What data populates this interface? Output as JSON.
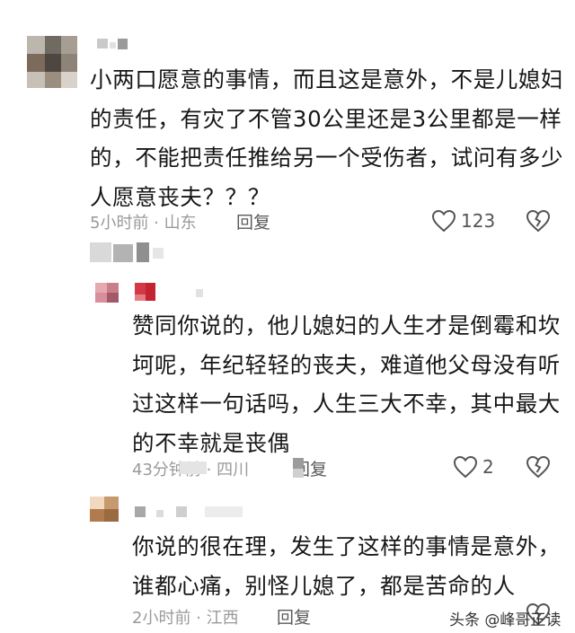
{
  "comments": [
    {
      "text_lines": [
        "小两口愿意的事情，而且这是意外，不是儿媳妇",
        "的责任，有灾了不管30公里还是3公里都是一样",
        "的，不能把责任推给另一个受伤者，试问有多少",
        "人愿意丧夫？？？"
      ],
      "time": "5小时前 · 山东",
      "reply_label": "回复",
      "likes": "123"
    },
    {
      "text_lines": [
        "赞同你说的，他儿媳妇的人生才是倒霉和坎",
        "坷呢，年纪轻轻的丧夫，难道他父母没有听",
        "过这样一句话吗，人生三大不幸，其中最大",
        "的不幸就是丧偶"
      ],
      "time": "43分钟前 · 四川",
      "reply_label": "回复",
      "likes": "2"
    },
    {
      "text_lines": [
        "你说的很在理，发生了这样的事情是意外，",
        "谁都心痛，别怪儿媳了，都是苦命的人"
      ],
      "time": "2小时前 · 江西",
      "reply_label": "回复"
    }
  ],
  "watermark": "头条 @峰哥正读",
  "icons": {
    "like": "heart-outline-icon",
    "dislike": "broken-heart-icon"
  },
  "colors": {
    "text": "#161616",
    "meta": "#9a9a9a",
    "icon": "#555555",
    "avatar_pink": "#e4a1a9",
    "avatar_red": "#d6303c"
  }
}
